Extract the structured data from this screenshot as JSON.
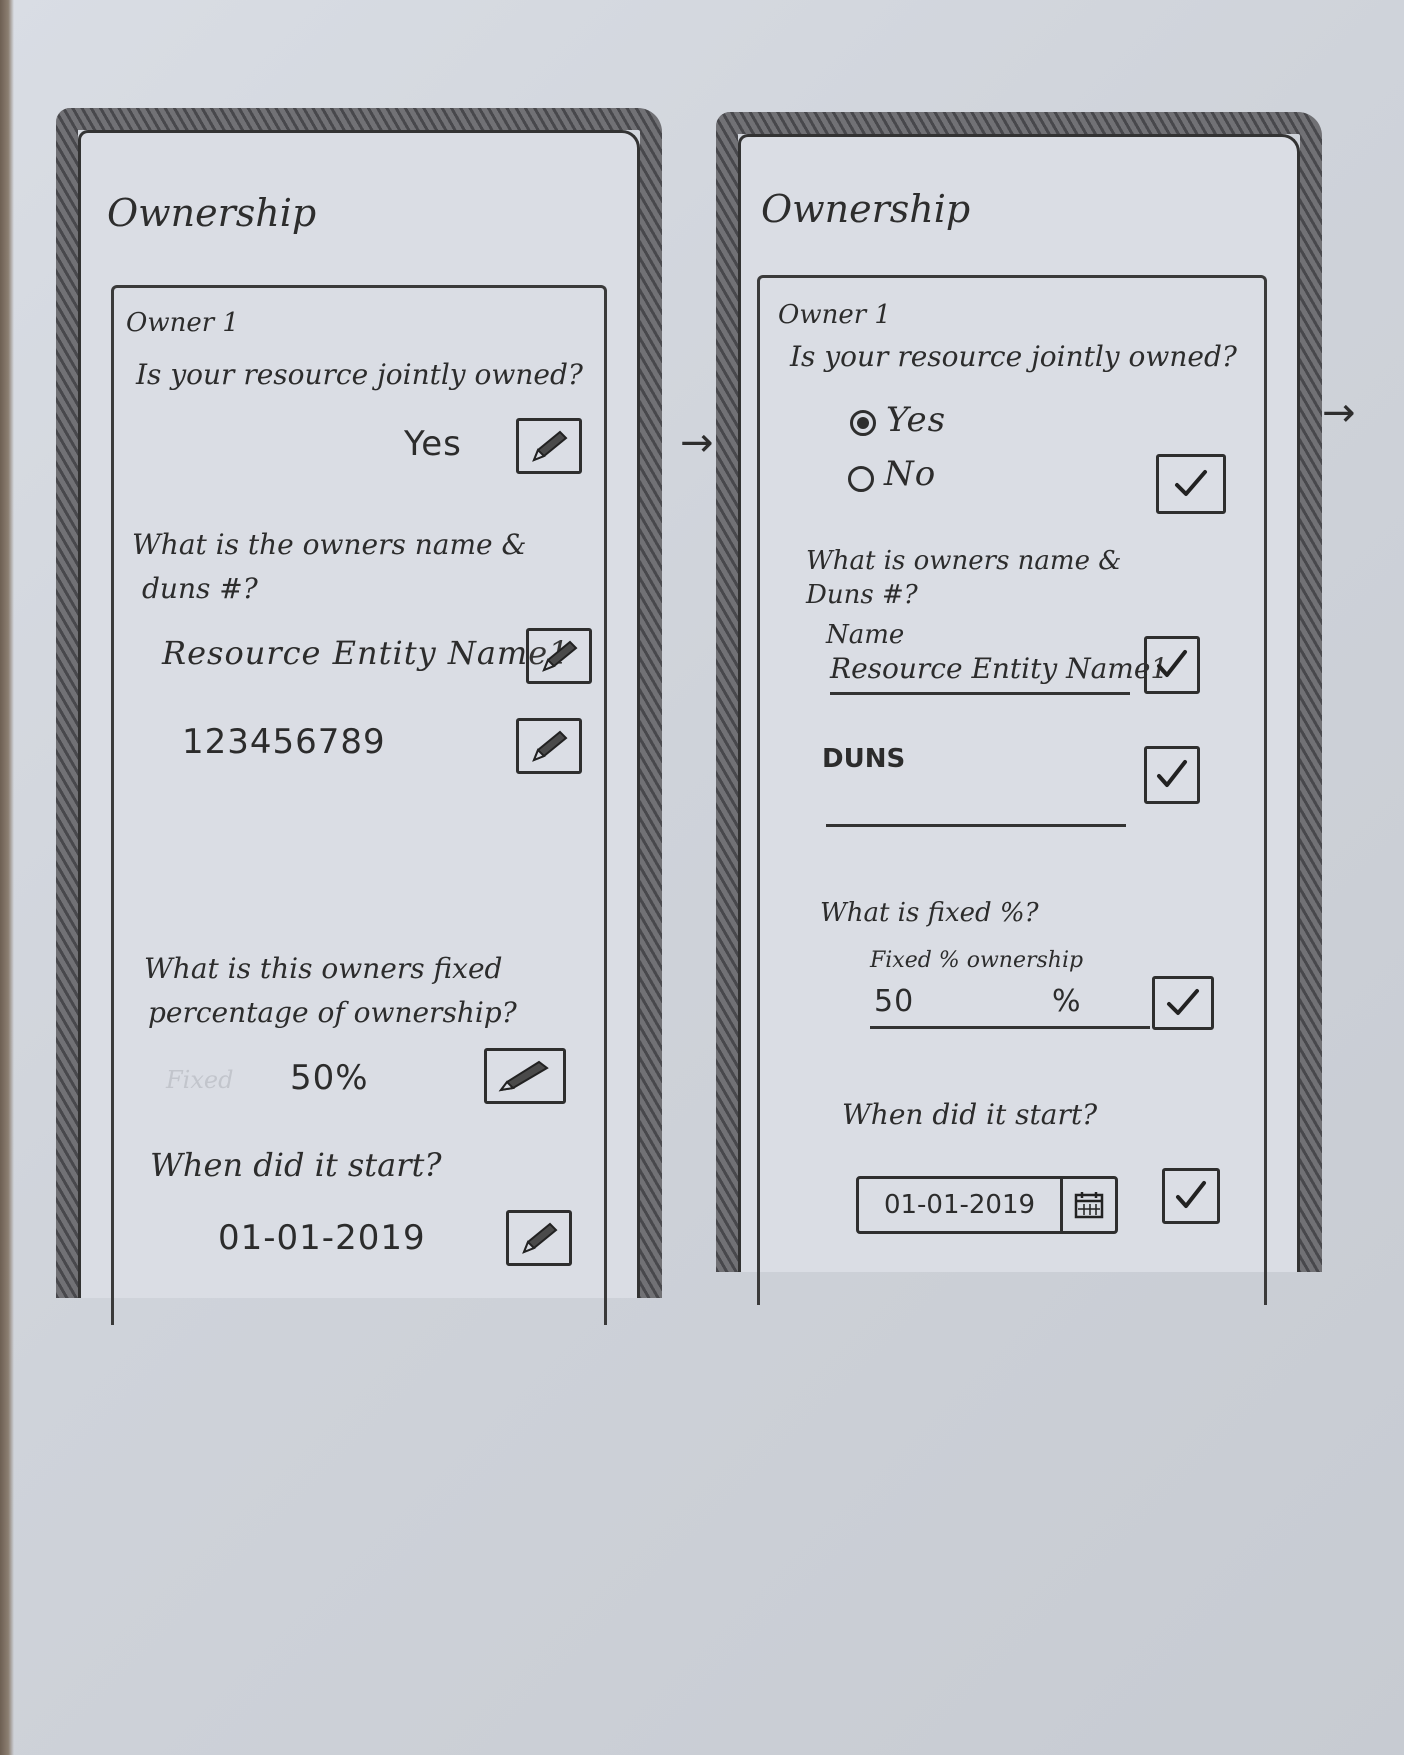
{
  "left_screen": {
    "title": "Ownership",
    "card_title": "Owner 1",
    "q_joint": "Is your resource jointly owned?",
    "joint_value": "Yes",
    "q_name": "What is the owners name &",
    "q_name_2": "duns #?",
    "name_value": "Resource Entity Name1",
    "duns_value": "123456789",
    "q_percent": "What is this owners fixed",
    "q_percent_2": "percentage of ownership?",
    "percent_faint": "Fixed",
    "percent_value": "50%",
    "q_start": "When did it start?",
    "start_value": "01-01-2019",
    "edit_icon": "pencil-icon"
  },
  "right_screen": {
    "title": "Ownership",
    "card_title": "Owner 1",
    "q_joint": "Is your resource jointly owned?",
    "option_yes": "Yes",
    "option_no": "No",
    "selected_option": "Yes",
    "q_name": "What is owners name &",
    "q_name_2": "Duns #?",
    "name_label": "Name",
    "name_value": "Resource Entity Name1",
    "duns_label": "DUNS",
    "duns_value": "",
    "q_fixed": "What is fixed %?",
    "fixed_label": "Fixed % ownership",
    "fixed_value": "50",
    "fixed_unit": "%",
    "q_start": "When did it start?",
    "start_value": "01-01-2019",
    "confirm_icon": "checkmark-icon",
    "calendar_icon": "calendar-icon"
  },
  "flow_arrows": [
    "→",
    "→"
  ]
}
